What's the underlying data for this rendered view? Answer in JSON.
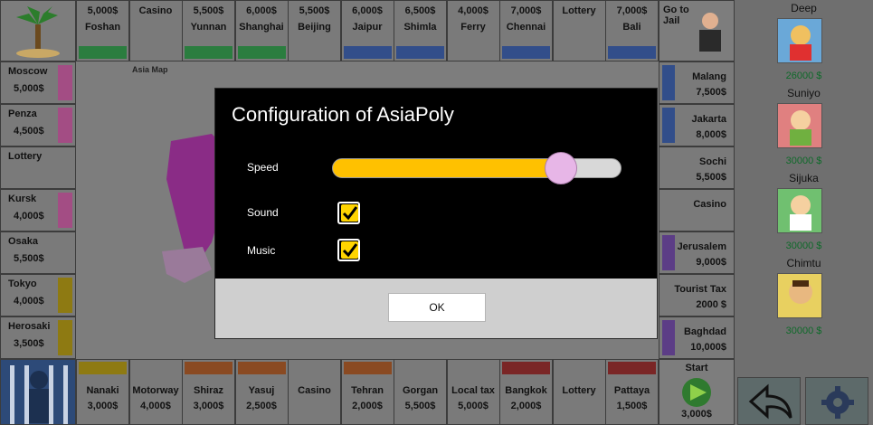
{
  "board": {
    "map_label": "Asia Map",
    "top_row": [
      {
        "name": "Foshan",
        "price": "5,000$",
        "band": "#2b7d3f"
      },
      {
        "name": "Casino",
        "price": "",
        "band": ""
      },
      {
        "name": "Yunnan",
        "price": "5,500$",
        "band": "#2b7d3f"
      },
      {
        "name": "Shanghai",
        "price": "6,000$",
        "band": "#2b7d3f"
      },
      {
        "name": "Beijing",
        "price": "5,500$",
        "band": ""
      },
      {
        "name": "Jaipur",
        "price": "6,000$",
        "band": "#324e8a"
      },
      {
        "name": "Shimla",
        "price": "6,500$",
        "band": "#324e8a"
      },
      {
        "name": "Ferry",
        "price": "4,000$",
        "band": ""
      },
      {
        "name": "Chennai",
        "price": "7,000$",
        "band": "#324e8a"
      },
      {
        "name": "Lottery",
        "price": "",
        "band": ""
      },
      {
        "name": "Bali",
        "price": "7,000$",
        "band": "#324e8a"
      }
    ],
    "go_to_jail": "Go to Jail",
    "left_col": [
      {
        "name": "Moscow",
        "price": "5,000$",
        "band": "#a34d84"
      },
      {
        "name": "Penza",
        "price": "4,500$",
        "band": "#a34d84"
      },
      {
        "name": "Lottery",
        "price": "",
        "band": ""
      },
      {
        "name": "Kursk",
        "price": "4,000$",
        "band": "#a34d84"
      },
      {
        "name": "Osaka",
        "price": "5,500$",
        "band": ""
      },
      {
        "name": "Tokyo",
        "price": "4,000$",
        "band": "#8e7a12"
      },
      {
        "name": "Herosaki",
        "price": "3,500$",
        "band": "#8e7a12"
      }
    ],
    "right_col": [
      {
        "name": "Malang",
        "price": "7,500$",
        "band": "#324e8a"
      },
      {
        "name": "Jakarta",
        "price": "8,000$",
        "band": "#324e8a"
      },
      {
        "name": "Sochi",
        "price": "5,500$",
        "band": ""
      },
      {
        "name": "Casino",
        "price": "",
        "band": ""
      },
      {
        "name": "Jerusalem",
        "price": "9,000$",
        "band": "#5c3d86"
      },
      {
        "name": "Tourist Tax",
        "price": "2000 $",
        "band": ""
      },
      {
        "name": "Baghdad",
        "price": "10,000$",
        "band": "#5c3d86"
      }
    ],
    "bottom_row": [
      {
        "name": "Nanaki",
        "price": "3,000$",
        "band": "#8e7a12"
      },
      {
        "name": "Motorway",
        "price": "4,000$",
        "band": ""
      },
      {
        "name": "Shiraz",
        "price": "3,000$",
        "band": "#8a4a22"
      },
      {
        "name": "Yasuj",
        "price": "2,500$",
        "band": "#8a4a22"
      },
      {
        "name": "Casino",
        "price": "",
        "band": ""
      },
      {
        "name": "Tehran",
        "price": "2,000$",
        "band": "#8a4a22"
      },
      {
        "name": "Gorgan",
        "price": "5,500$",
        "band": ""
      },
      {
        "name": "Local tax",
        "price": "5,000$",
        "band": ""
      },
      {
        "name": "Bangkok",
        "price": "2,000$",
        "band": "#7a2626"
      },
      {
        "name": "Lottery",
        "price": "",
        "band": ""
      },
      {
        "name": "Pattaya",
        "price": "1,500$",
        "band": "#7a2626"
      }
    ],
    "start_label": "Start",
    "start_amount": "3,000$"
  },
  "players": [
    {
      "name": "Deep",
      "money": "26000 $"
    },
    {
      "name": "Suniyo",
      "money": "30000 $"
    },
    {
      "name": "Sijuka",
      "money": "30000 $"
    },
    {
      "name": "Chimtu",
      "money": "30000 $"
    }
  ],
  "dialog": {
    "title": "Configuration of AsiaPoly",
    "speed_label": "Speed",
    "speed_fraction": 0.79,
    "sound_label": "Sound",
    "sound_checked": true,
    "music_label": "Music",
    "music_checked": true,
    "ok_label": "OK"
  },
  "icons": {
    "back": "back-arrow-icon",
    "settings": "gear-icon"
  }
}
